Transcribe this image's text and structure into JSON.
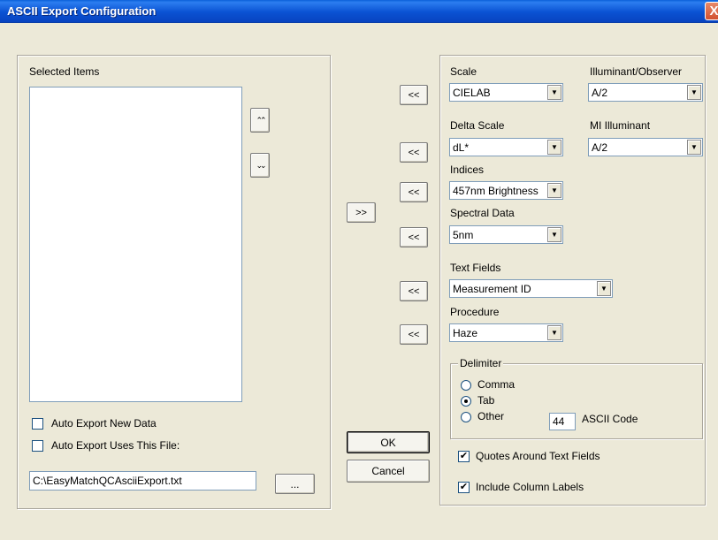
{
  "window": {
    "title": "ASCII Export Configuration",
    "close_glyph": "X"
  },
  "left": {
    "group_label": "Selected Items",
    "move_up_glyph": "⌃⌃",
    "move_down_glyph": "⌄⌄",
    "auto_export_new_label": "Auto Export New Data",
    "auto_export_file_label": "Auto Export Uses This File:",
    "file_path": "C:\\EasyMatchQCAsciiExport.txt",
    "browse_label": "..."
  },
  "center": {
    "add_label": ">>",
    "remove_label": "<<",
    "ok_label": "OK",
    "cancel_label": "Cancel"
  },
  "right": {
    "scale_label": "Scale",
    "scale_value": "CIELAB",
    "illuminant_label": "Illuminant/Observer",
    "illuminant_value": "A/2",
    "delta_scale_label": "Delta Scale",
    "delta_scale_value": "dL*",
    "mi_illuminant_label": "MI Illuminant",
    "mi_illuminant_value": "A/2",
    "indices_label": "Indices",
    "indices_value": "457nm Brightness",
    "spectral_label": "Spectral Data",
    "spectral_value": "5nm",
    "text_fields_label": "Text Fields",
    "text_fields_value": "Measurement ID",
    "procedure_label": "Procedure",
    "procedure_value": "Haze",
    "delimiter": {
      "label": "Delimiter",
      "comma": "Comma",
      "tab": "Tab",
      "other": "Other",
      "selected": "Tab",
      "ascii_value": "44",
      "ascii_label": "ASCII Code"
    },
    "quotes_label": "Quotes Around Text Fields",
    "quotes_checked": true,
    "column_labels_label": "Include Column Labels",
    "column_labels_checked": true
  },
  "icons": {
    "check": "✔",
    "dropdown": "▼"
  }
}
